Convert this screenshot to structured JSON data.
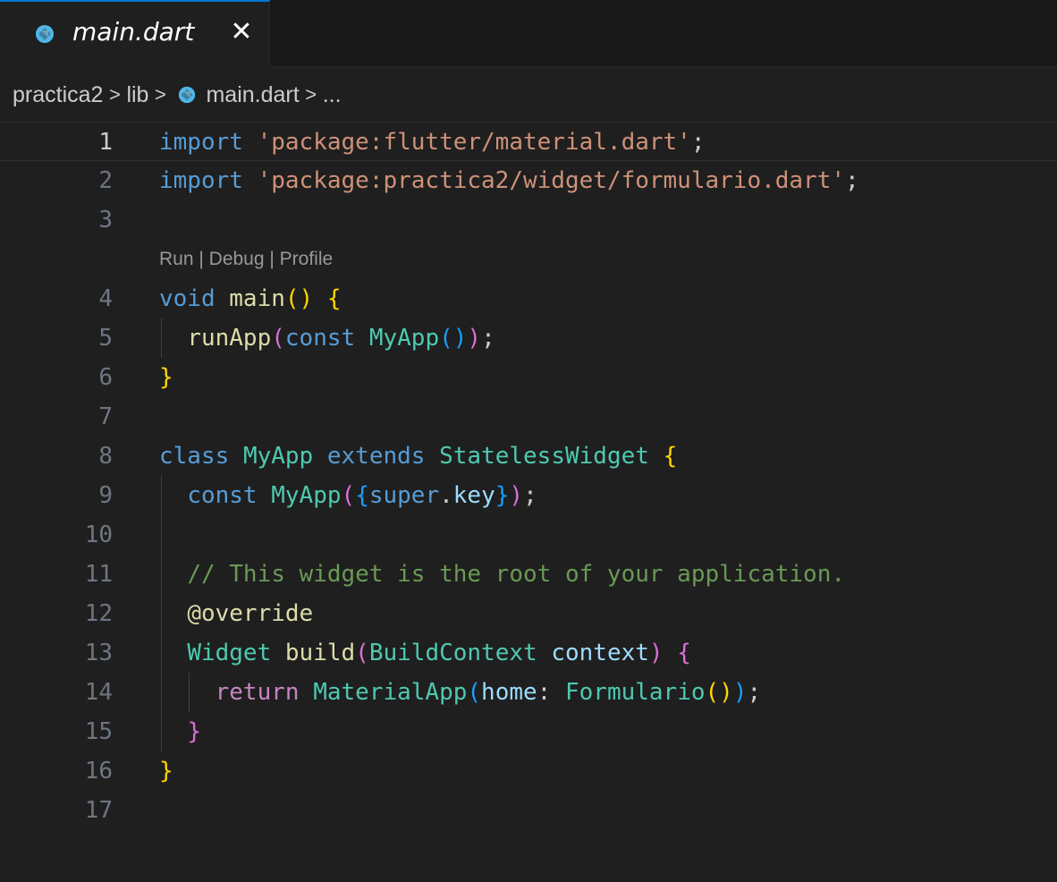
{
  "tab": {
    "title": "main.dart",
    "close": "✕"
  },
  "breadcrumb": [
    "practica2",
    "lib",
    "main.dart",
    "..."
  ],
  "breadcrumb_separator": ">",
  "codelens": "Run | Debug | Profile",
  "current_line": 1,
  "lines": [
    {
      "n": "1",
      "tokens": [
        [
          "kw",
          "import"
        ],
        [
          "plain",
          " "
        ],
        [
          "str",
          "'package:flutter/material.dart'"
        ],
        [
          "plain",
          ";"
        ]
      ]
    },
    {
      "n": "2",
      "tokens": [
        [
          "kw",
          "import"
        ],
        [
          "plain",
          " "
        ],
        [
          "str",
          "'package:practica2/widget/formulario.dart'"
        ],
        [
          "plain",
          ";"
        ]
      ]
    },
    {
      "n": "3",
      "tokens": []
    },
    {
      "n": "4",
      "tokens": [
        [
          "kw",
          "void"
        ],
        [
          "plain",
          " "
        ],
        [
          "fn",
          "main"
        ],
        [
          "b1",
          "()"
        ],
        [
          "plain",
          " "
        ],
        [
          "b1",
          "{"
        ]
      ]
    },
    {
      "n": "5",
      "tokens": [
        [
          "plain",
          "  "
        ],
        [
          "fn",
          "runApp"
        ],
        [
          "b2",
          "("
        ],
        [
          "kw",
          "const"
        ],
        [
          "plain",
          " "
        ],
        [
          "cls",
          "MyApp"
        ],
        [
          "b3",
          "()"
        ],
        [
          "b2",
          ")"
        ],
        [
          "plain",
          ";"
        ]
      ]
    },
    {
      "n": "6",
      "tokens": [
        [
          "b1",
          "}"
        ]
      ]
    },
    {
      "n": "7",
      "tokens": []
    },
    {
      "n": "8",
      "tokens": [
        [
          "kw",
          "class"
        ],
        [
          "plain",
          " "
        ],
        [
          "cls",
          "MyApp"
        ],
        [
          "plain",
          " "
        ],
        [
          "kw",
          "extends"
        ],
        [
          "plain",
          " "
        ],
        [
          "cls",
          "StatelessWidget"
        ],
        [
          "plain",
          " "
        ],
        [
          "b1",
          "{"
        ]
      ]
    },
    {
      "n": "9",
      "tokens": [
        [
          "plain",
          "  "
        ],
        [
          "kw",
          "const"
        ],
        [
          "plain",
          " "
        ],
        [
          "cls",
          "MyApp"
        ],
        [
          "b2",
          "("
        ],
        [
          "b3",
          "{"
        ],
        [
          "kw",
          "super"
        ],
        [
          "plain",
          "."
        ],
        [
          "var",
          "key"
        ],
        [
          "b3",
          "}"
        ],
        [
          "b2",
          ")"
        ],
        [
          "plain",
          ";"
        ]
      ]
    },
    {
      "n": "10",
      "tokens": []
    },
    {
      "n": "11",
      "tokens": [
        [
          "plain",
          "  "
        ],
        [
          "cmt",
          "// This widget is the root of your application."
        ]
      ]
    },
    {
      "n": "12",
      "tokens": [
        [
          "plain",
          "  "
        ],
        [
          "fn",
          "@override"
        ]
      ]
    },
    {
      "n": "13",
      "tokens": [
        [
          "plain",
          "  "
        ],
        [
          "cls",
          "Widget"
        ],
        [
          "plain",
          " "
        ],
        [
          "fn",
          "build"
        ],
        [
          "b2",
          "("
        ],
        [
          "cls",
          "BuildContext"
        ],
        [
          "plain",
          " "
        ],
        [
          "var",
          "context"
        ],
        [
          "b2",
          ")"
        ],
        [
          "plain",
          " "
        ],
        [
          "b2",
          "{"
        ]
      ]
    },
    {
      "n": "14",
      "tokens": [
        [
          "plain",
          "    "
        ],
        [
          "ctrl",
          "return"
        ],
        [
          "plain",
          " "
        ],
        [
          "cls",
          "MaterialApp"
        ],
        [
          "b3",
          "("
        ],
        [
          "var",
          "home"
        ],
        [
          "plain",
          ": "
        ],
        [
          "cls",
          "Formulario"
        ],
        [
          "b1",
          "()"
        ],
        [
          "b3",
          ")"
        ],
        [
          "plain",
          ";"
        ]
      ]
    },
    {
      "n": "15",
      "tokens": [
        [
          "plain",
          "  "
        ],
        [
          "b2",
          "}"
        ]
      ]
    },
    {
      "n": "16",
      "tokens": [
        [
          "b1",
          "}"
        ]
      ]
    },
    {
      "n": "17",
      "tokens": []
    }
  ],
  "colors": {
    "background": "#1f1f1f",
    "keyword": "#569cd6",
    "string": "#ce9178",
    "function": "#dcdcaa",
    "class": "#4ec9b0",
    "variable": "#9cdcfe",
    "comment": "#6a9955",
    "bracket1": "#ffd700",
    "bracket2": "#da70d6",
    "bracket3": "#179fff",
    "dart_icon": "#4fb7e8"
  },
  "icons": {
    "file": "dart-file-icon"
  }
}
